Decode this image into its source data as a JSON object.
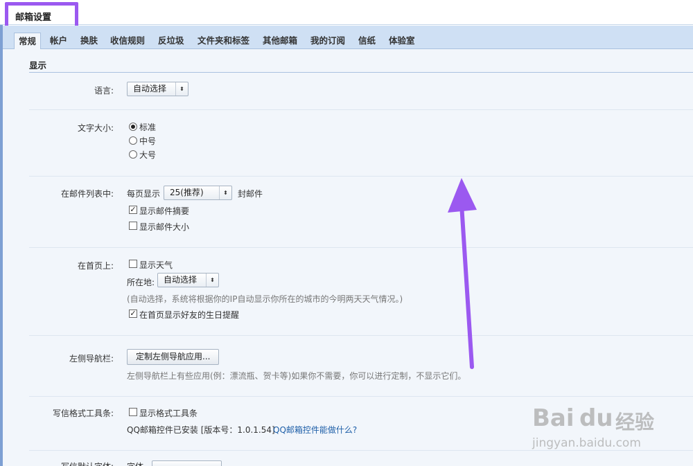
{
  "window": {
    "title": "邮箱设置"
  },
  "tabs": [
    {
      "label": "常规",
      "active": true
    },
    {
      "label": "帐户",
      "active": false
    },
    {
      "label": "换肤",
      "active": false
    },
    {
      "label": "收信规则",
      "active": false
    },
    {
      "label": "反垃圾",
      "active": false
    },
    {
      "label": "文件夹和标签",
      "active": false
    },
    {
      "label": "其他邮箱",
      "active": false
    },
    {
      "label": "我的订阅",
      "active": false
    },
    {
      "label": "信纸",
      "active": false
    },
    {
      "label": "体验室",
      "active": false
    }
  ],
  "section": {
    "title": "显示"
  },
  "language": {
    "label": "语言:",
    "value": "自动选择"
  },
  "font_size": {
    "label": "文字大小:",
    "options": [
      {
        "label": "标准",
        "selected": true
      },
      {
        "label": "中号",
        "selected": false
      },
      {
        "label": "大号",
        "selected": false
      }
    ]
  },
  "mail_list": {
    "label": "在邮件列表中:",
    "per_page_prefix": "每页显示",
    "per_page_value": "25(推荐)",
    "per_page_suffix": "封邮件",
    "show_summary": {
      "label": "显示邮件摘要",
      "checked": true
    },
    "show_size": {
      "label": "显示邮件大小",
      "checked": false
    }
  },
  "homepage": {
    "label": "在首页上:",
    "show_weather": {
      "label": "显示天气",
      "checked": false
    },
    "location_label": "所在地:",
    "location_value": "自动选择",
    "hint": "(自动选择，系统将根据你的IP自动显示你所在的城市的今明两天天气情况。)",
    "birthday": {
      "label": "在首页显示好友的生日提醒",
      "checked": true
    }
  },
  "left_nav": {
    "label": "左侧导航栏:",
    "button": "定制左侧导航应用...",
    "hint": "左侧导航栏上有些应用(例：漂流瓶、贺卡等)如果你不需要，你可以进行定制，不显示它们。"
  },
  "compose_toolbar": {
    "label": "写信格式工具条:",
    "show_toolbar": {
      "label": "显示格式工具条",
      "checked": false
    },
    "installed": "QQ邮箱控件已安装 [版本号：1.0.1.54]",
    "link": "QQ邮箱控件能做什么?"
  },
  "compose_font": {
    "label": "写信默认字体:",
    "prefix": "字体"
  },
  "watermark": {
    "brand": "Bai",
    "brand2": "du",
    "cn": "经验",
    "url": "jingyan.baidu.com"
  },
  "colors": {
    "accent": "#9b59f0",
    "tabbar": "#cfe0f4",
    "content": "#f2f6fb",
    "link": "#1e5fa8"
  }
}
